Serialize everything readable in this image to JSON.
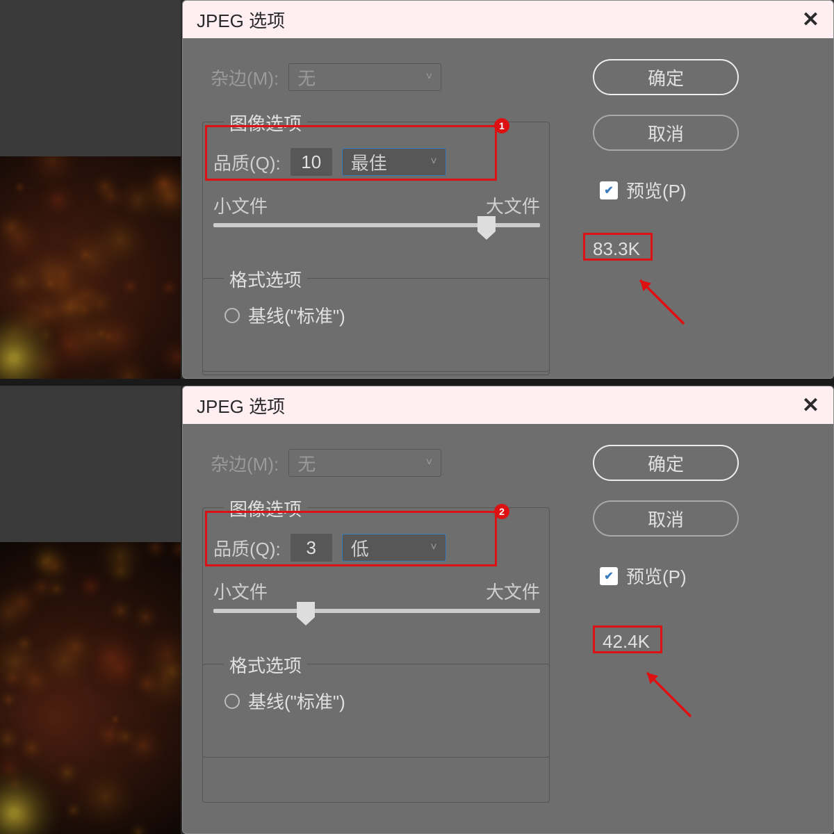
{
  "dialog1": {
    "title": "JPEG 选项",
    "matte_label": "杂边(M):",
    "matte_value": "无",
    "image_options_legend": "图像选项",
    "quality_label": "品质(Q):",
    "quality_value": "10",
    "quality_preset": "最佳",
    "slider_min_label": "小文件",
    "slider_max_label": "大文件",
    "format_options_legend": "格式选项",
    "baseline_label": "基线(\"标准\")",
    "ok_label": "确定",
    "cancel_label": "取消",
    "preview_label": "预览(P)",
    "preview_checked": true,
    "filesize": "83.3K",
    "badge": "1"
  },
  "dialog2": {
    "title": "JPEG 选项",
    "matte_label": "杂边(M):",
    "matte_value": "无",
    "image_options_legend": "图像选项",
    "quality_label": "品质(Q):",
    "quality_value": "3",
    "quality_preset": "低",
    "slider_min_label": "小文件",
    "slider_max_label": "大文件",
    "format_options_legend": "格式选项",
    "baseline_label": "基线(\"标准\")",
    "ok_label": "确定",
    "cancel_label": "取消",
    "preview_label": "预览(P)",
    "preview_checked": true,
    "filesize": "42.4K",
    "badge": "2"
  }
}
